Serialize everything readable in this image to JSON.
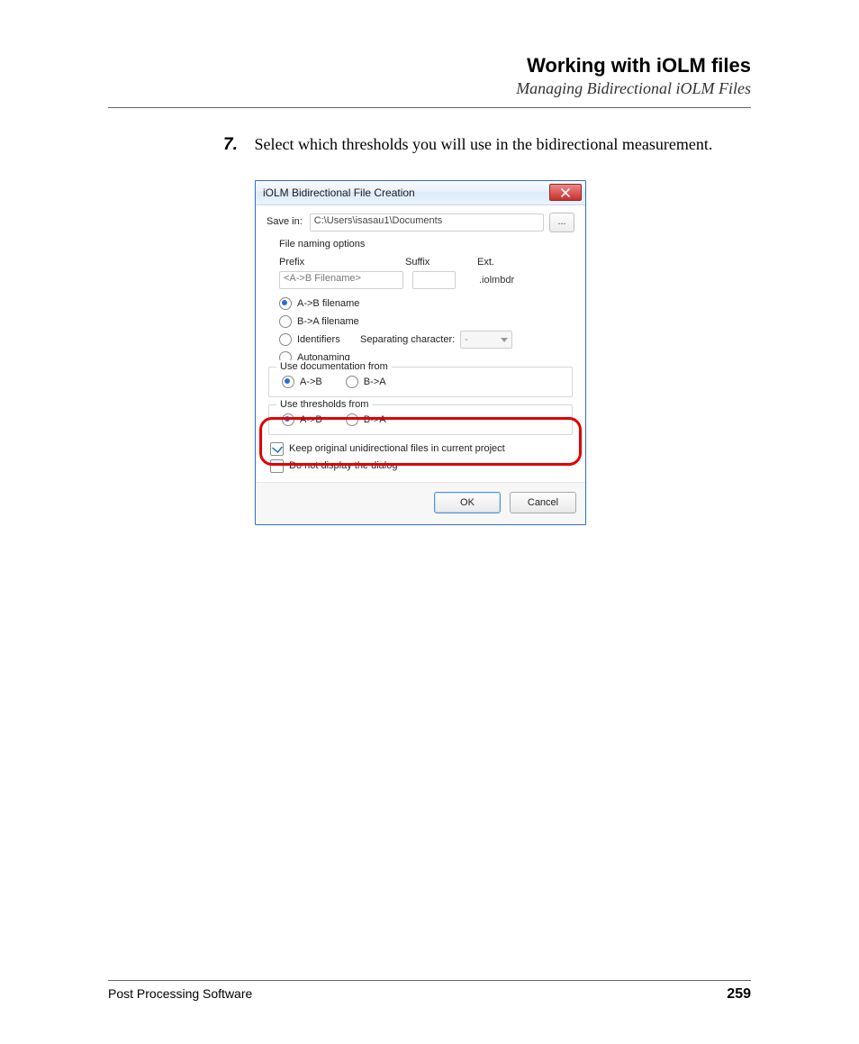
{
  "header": {
    "title": "Working with iOLM files",
    "subtitle": "Managing Bidirectional iOLM Files"
  },
  "step": {
    "number": "7.",
    "text": "Select which thresholds you will use in the bidirectional measurement."
  },
  "dialog": {
    "title": "iOLM Bidirectional File Creation",
    "save_in_label": "Save in:",
    "save_in_path": "C:\\Users\\isasau1\\Documents",
    "browse_label": "...",
    "naming": {
      "group_label": "File naming options",
      "prefix_label": "Prefix",
      "suffix_label": "Suffix",
      "ext_label": "Ext.",
      "prefix_value": "<A->B Filename>",
      "ext_value": ".iolmbdr",
      "options": {
        "ab": "A->B filename",
        "ba": "B->A filename",
        "identifiers": "Identifiers",
        "autonaming": "Autonaming"
      },
      "sep_label": "Separating character:",
      "sep_value": "-"
    },
    "doc_from": {
      "legend": "Use documentation from",
      "ab": "A->B",
      "ba": "B->A"
    },
    "thr_from": {
      "legend": "Use thresholds from",
      "ab": "A->B",
      "ba": "B->A"
    },
    "keep_original": "Keep original unidirectional files in current project",
    "no_display": "Do not display the dialog",
    "ok": "OK",
    "cancel": "Cancel"
  },
  "footer": {
    "left": "Post Processing Software",
    "page": "259"
  }
}
